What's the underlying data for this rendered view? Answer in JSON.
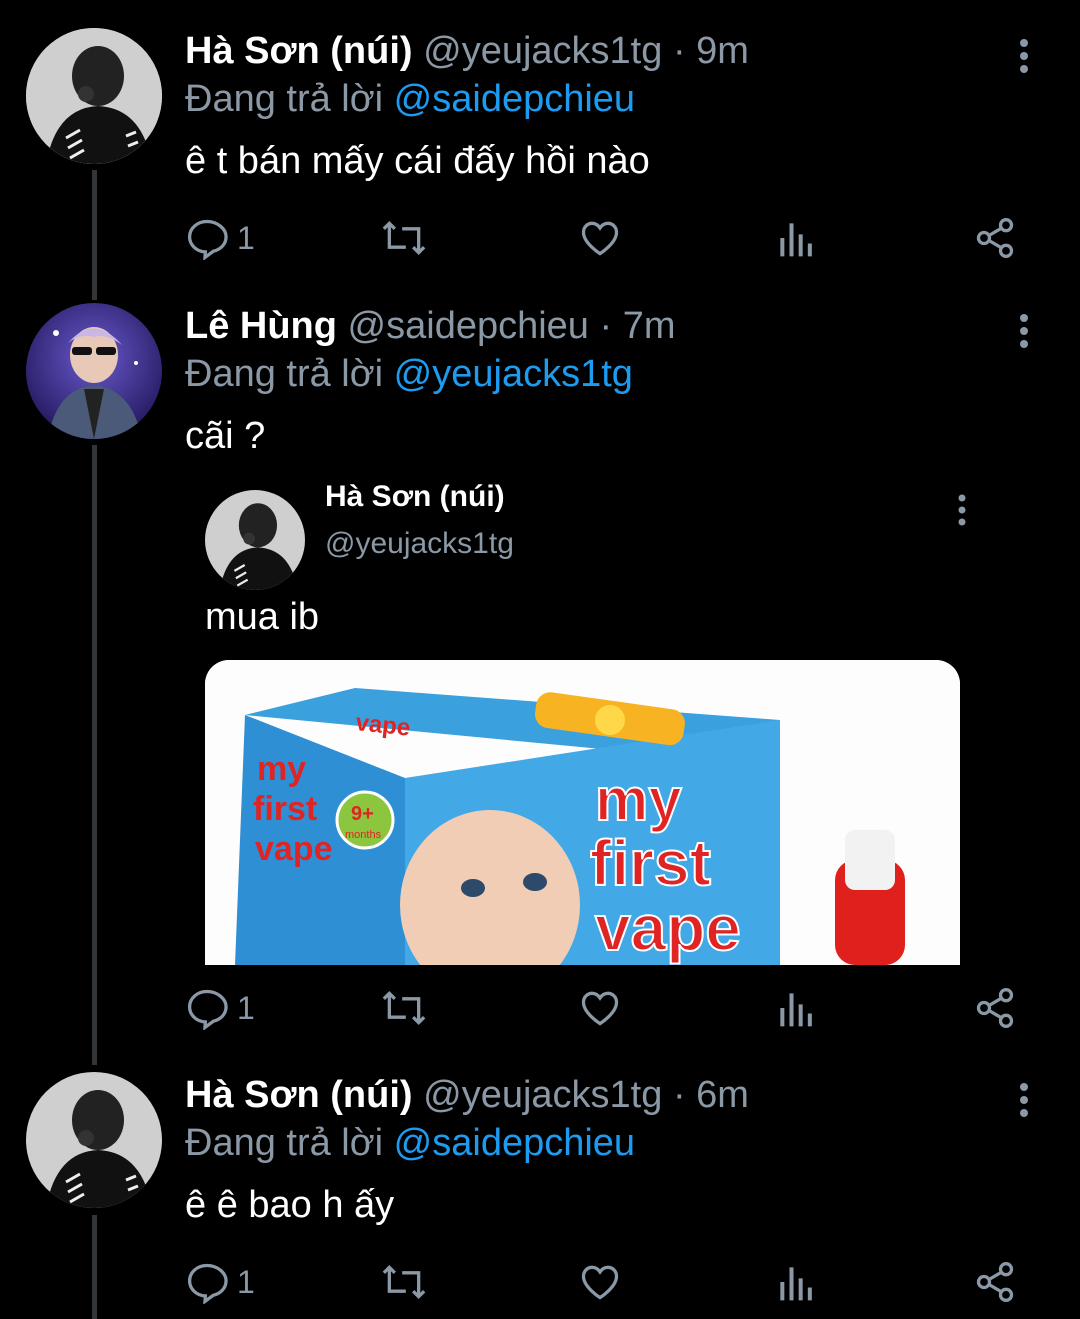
{
  "tweets": [
    {
      "name": "Hà Sơn (núi)",
      "handle": "@yeujacks1tg",
      "time": "· 9m",
      "reply_prefix": "Đang trả lời",
      "reply_to": "@saidepchieu",
      "text": "ê t bán mấy cái đấy hồi nào",
      "reply_count": "1"
    },
    {
      "name": "Lê Hùng",
      "handle": "@saidepchieu",
      "time": "· 7m",
      "reply_prefix": "Đang trả lời",
      "reply_to": "@yeujacks1tg",
      "text": "cãi ?",
      "reply_count": "1",
      "quote": {
        "name": "Hà Sơn (núi)",
        "handle": "@yeujacks1tg",
        "text": "mua ib",
        "media_text": {
          "box_brand_line1": "my",
          "box_brand_line2": "first",
          "box_brand_line3": "vape",
          "badge": "9+",
          "badge_sub": "months"
        }
      }
    },
    {
      "name": "Hà Sơn (núi)",
      "handle": "@yeujacks1tg",
      "time": "· 6m",
      "reply_prefix": "Đang trả lời",
      "reply_to": "@saidepchieu",
      "text": "ê ê bao h ấy",
      "reply_count": "1"
    }
  ],
  "colors": {
    "background": "#000000",
    "secondary_text": "#8b98a5",
    "mention": "#1d9bf0",
    "thread_line": "#333639"
  },
  "icons": [
    "reply-icon",
    "retweet-icon",
    "like-icon",
    "views-icon",
    "share-icon",
    "more-icon"
  ]
}
